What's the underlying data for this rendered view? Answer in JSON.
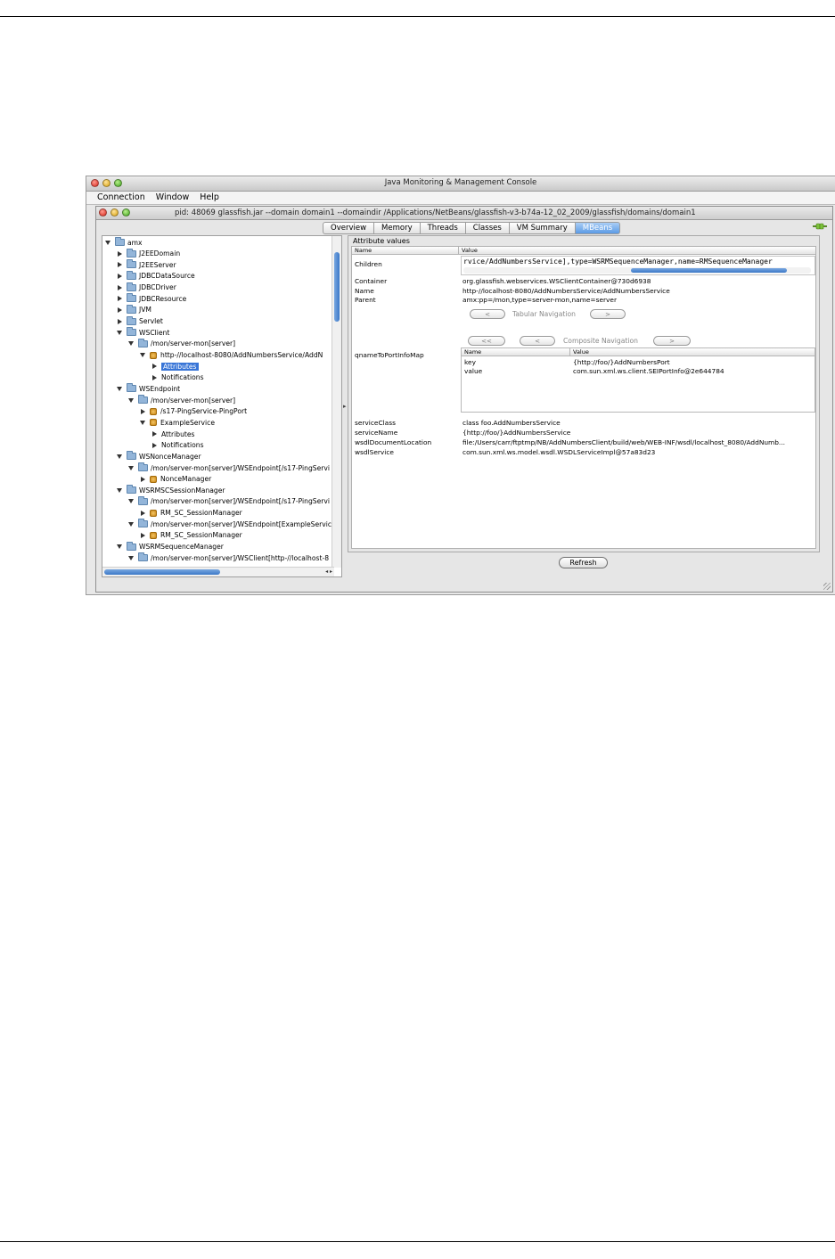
{
  "app": {
    "title": "Java Monitoring & Management Console",
    "menus": [
      "Connection",
      "Window",
      "Help"
    ]
  },
  "inner": {
    "title": "pid: 48069 glassfish.jar --domain domain1 --domaindir /Applications/NetBeans/glassfish-v3-b74a-12_02_2009/glassfish/domains/domain1",
    "tabs": [
      "Overview",
      "Memory",
      "Threads",
      "Classes",
      "VM Summary",
      "MBeans"
    ],
    "active_tab": "MBeans"
  },
  "tree": [
    {
      "level": 0,
      "open": true,
      "icon": "folder-icon",
      "label": "amx"
    },
    {
      "level": 1,
      "open": false,
      "icon": "folder-icon",
      "label": "J2EEDomain"
    },
    {
      "level": 1,
      "open": false,
      "icon": "folder-icon",
      "label": "J2EEServer"
    },
    {
      "level": 1,
      "open": false,
      "icon": "folder-icon",
      "label": "JDBCDataSource"
    },
    {
      "level": 1,
      "open": false,
      "icon": "folder-icon",
      "label": "JDBCDriver"
    },
    {
      "level": 1,
      "open": false,
      "icon": "folder-icon",
      "label": "JDBCResource"
    },
    {
      "level": 1,
      "open": false,
      "icon": "folder-icon",
      "label": "JVM"
    },
    {
      "level": 1,
      "open": false,
      "icon": "folder-icon",
      "label": "Servlet"
    },
    {
      "level": 1,
      "open": true,
      "icon": "folder-icon",
      "label": "WSClient"
    },
    {
      "level": 2,
      "open": true,
      "icon": "folder-icon",
      "label": "/mon/server-mon[server]"
    },
    {
      "level": 3,
      "open": true,
      "icon": "bean-icon",
      "label": "http-//localhost-8080/AddNumbersService/AddN"
    },
    {
      "level": 4,
      "open": false,
      "icon": "",
      "label": "Attributes",
      "selected": true
    },
    {
      "level": 4,
      "open": false,
      "icon": "",
      "label": "Notifications"
    },
    {
      "level": 1,
      "open": true,
      "icon": "folder-icon",
      "label": "WSEndpoint"
    },
    {
      "level": 2,
      "open": true,
      "icon": "folder-icon",
      "label": "/mon/server-mon[server]"
    },
    {
      "level": 3,
      "open": false,
      "icon": "bean-icon",
      "label": "/s17-PingService-PingPort"
    },
    {
      "level": 3,
      "open": true,
      "icon": "bean-icon",
      "label": "ExampleService"
    },
    {
      "level": 4,
      "open": false,
      "icon": "",
      "label": "Attributes"
    },
    {
      "level": 4,
      "open": false,
      "icon": "",
      "label": "Notifications"
    },
    {
      "level": 1,
      "open": true,
      "icon": "folder-icon",
      "label": "WSNonceManager"
    },
    {
      "level": 2,
      "open": true,
      "icon": "folder-icon",
      "label": "/mon/server-mon[server]/WSEndpoint[/s17-PingServi"
    },
    {
      "level": 3,
      "open": false,
      "icon": "bean-icon",
      "label": "NonceManager"
    },
    {
      "level": 1,
      "open": true,
      "icon": "folder-icon",
      "label": "WSRMSCSessionManager"
    },
    {
      "level": 2,
      "open": true,
      "icon": "folder-icon",
      "label": "/mon/server-mon[server]/WSEndpoint[/s17-PingServi"
    },
    {
      "level": 3,
      "open": false,
      "icon": "bean-icon",
      "label": "RM_SC_SessionManager"
    },
    {
      "level": 2,
      "open": true,
      "icon": "folder-icon",
      "label": "/mon/server-mon[server]/WSEndpoint[ExampleService"
    },
    {
      "level": 3,
      "open": false,
      "icon": "bean-icon",
      "label": "RM_SC_SessionManager"
    },
    {
      "level": 1,
      "open": true,
      "icon": "folder-icon",
      "label": "WSRMSequenceManager"
    },
    {
      "level": 2,
      "open": true,
      "icon": "folder-icon",
      "label": "/mon/server-mon[server]/WSClient[http-//localhost-8"
    }
  ],
  "attributes": {
    "group_label": "Attribute values",
    "col_name": "Name",
    "col_value": "Value",
    "children_label": "Children",
    "children_value": "rvice/AddNumbersService],type=WSRMSequenceManager,name=RMSequenceManager",
    "rows": [
      {
        "name": "Container",
        "value": "org.glassfish.webservices.WSClientContainer@730d6938"
      },
      {
        "name": "Name",
        "value": "http-//localhost-8080/AddNumbersService/AddNumbersService"
      },
      {
        "name": "Parent",
        "value": "amx:pp=/mon,type=server-mon,name=server"
      }
    ],
    "tabular_nav": {
      "prev": "<",
      "label": "Tabular Navigation",
      "next": ">"
    },
    "composite_nav": {
      "first": "<<",
      "prev": "<",
      "label": "Composite Navigation",
      "next": ">"
    },
    "qname_label": "qnameToPortInfoMap",
    "qname_table": {
      "col_name": "Name",
      "col_value": "Value",
      "rows": [
        {
          "name": "key",
          "value": "{http://foo/}AddNumbersPort"
        },
        {
          "name": "value",
          "value": "com.sun.xml.ws.client.SEIPortInfo@2e644784"
        }
      ]
    },
    "rows2": [
      {
        "name": "serviceClass",
        "value": "class foo.AddNumbersService"
      },
      {
        "name": "serviceName",
        "value": "{http://foo/}AddNumbersService"
      },
      {
        "name": "wsdlDocumentLocation",
        "value": "file:/Users/carr/ftptmp/NB/AddNumbersClient/build/web/WEB-INF/wsdl/localhost_8080/AddNumb..."
      },
      {
        "name": "wsdlService",
        "value": "com.sun.xml.ws.model.wsdl.WSDLServiceImpl@57a83d23"
      }
    ]
  },
  "refresh_label": "Refresh"
}
